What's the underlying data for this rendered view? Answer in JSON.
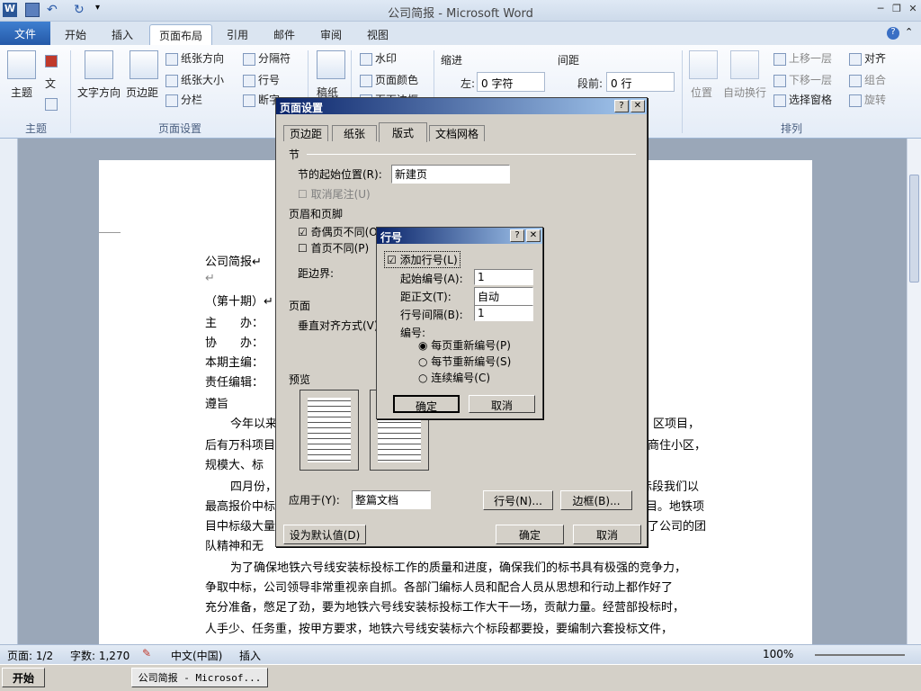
{
  "app": {
    "title": "公司简报 - Microsoft Word"
  },
  "tabs": [
    "文件",
    "开始",
    "插入",
    "页面布局",
    "引用",
    "邮件",
    "审阅",
    "视图"
  ],
  "ribbon": {
    "theme": {
      "label": "主题",
      "group": "主题"
    },
    "page_setup": {
      "text_dir": "文字方向",
      "margins": "页边距",
      "orientation": "纸张方向",
      "size": "纸张大小",
      "columns": "分栏",
      "breaks": "分隔符",
      "line_numbers": "行号",
      "hyphen": "断字",
      "group": "页面设置"
    },
    "background": {
      "watermark": "水印",
      "page_color": "页面颜色",
      "borders": "页面边框",
      "manuscript": "稿纸"
    },
    "paragraph": {
      "indent": "缩进",
      "left": "左:",
      "left_val": "0 字符",
      "spacing": "间距",
      "before": "段前:",
      "before_val": "0 行"
    },
    "arrange": {
      "position": "位置",
      "wrap": "自动换行",
      "forward": "上移一层",
      "backward": "下移一层",
      "pane": "选择窗格",
      "align": "对齐",
      "group_btn": "组合",
      "rotate": "旋转",
      "group": "排列"
    }
  },
  "doc": {
    "lines": [
      "公司简报↵",
      "↵",
      "（第十期）↵",
      "主　　办：",
      "协　　办：",
      "本期主编：",
      "责任编辑：",
      "遵旨",
      "今年以来",
      "后有万科项目",
      "规模大、标",
      "四月份，",
      "最高报价中标",
      "目中标级大量",
      "队精神和无",
      "为了确保地铁六号线安装标投标工作的质量和进度，确保我们的标书具有极强的竞争力，",
      "争取中标，公司领导非常重视亲自抓。各部门编标人员和配合人员从思想和行动上都作好了",
      "充分准备，憋足了劲，要为地铁六号线安装标投标工作大干一场，贡献力量。经营部投标时，",
      "人手少、任务重，按甲方要求，地铁六号线安装标六个标段都要投，要编制六套投标文件，"
    ],
    "right": [
      "区项目，",
      "商住小区，",
      "标段我们以",
      "目。地铁项",
      "了公司的团"
    ]
  },
  "page_setup_dlg": {
    "title": "页面设置",
    "tabs": [
      "页边距",
      "纸张",
      "版式",
      "文档网格"
    ],
    "section": "节",
    "start_label": "节的起始位置(R):",
    "start_val": "新建页",
    "suppress": "取消尾注(U)",
    "hf": "页眉和页脚",
    "odd_even": "奇偶页不同(O)",
    "first": "首页不同(P)",
    "from_edge": "距边界:",
    "page": "页面",
    "valign": "垂直对齐方式(V)",
    "preview": "预览",
    "apply_label": "应用于(Y):",
    "apply_val": "整篇文档",
    "line_num_btn": "行号(N)...",
    "borders_btn": "边框(B)...",
    "default_btn": "设为默认值(D)",
    "ok": "确定",
    "cancel": "取消"
  },
  "line_num_dlg": {
    "title": "行号",
    "add": "添加行号(L)",
    "start_label": "起始编号(A):",
    "start_val": "1",
    "from_text_label": "距正文(T):",
    "from_text_val": "自动",
    "interval_label": "行号间隔(B):",
    "interval_val": "1",
    "numbering": "编号:",
    "opt1": "每页重新编号(P)",
    "opt2": "每节重新编号(S)",
    "opt3": "连续编号(C)",
    "ok": "确定",
    "cancel": "取消"
  },
  "status": {
    "page": "页面: 1/2",
    "words": "字数: 1,270",
    "lang": "中文(中国)",
    "mode": "插入",
    "zoom": "100%"
  },
  "taskbar": {
    "start": "开始",
    "task": "公司简报 - Microsof..."
  }
}
